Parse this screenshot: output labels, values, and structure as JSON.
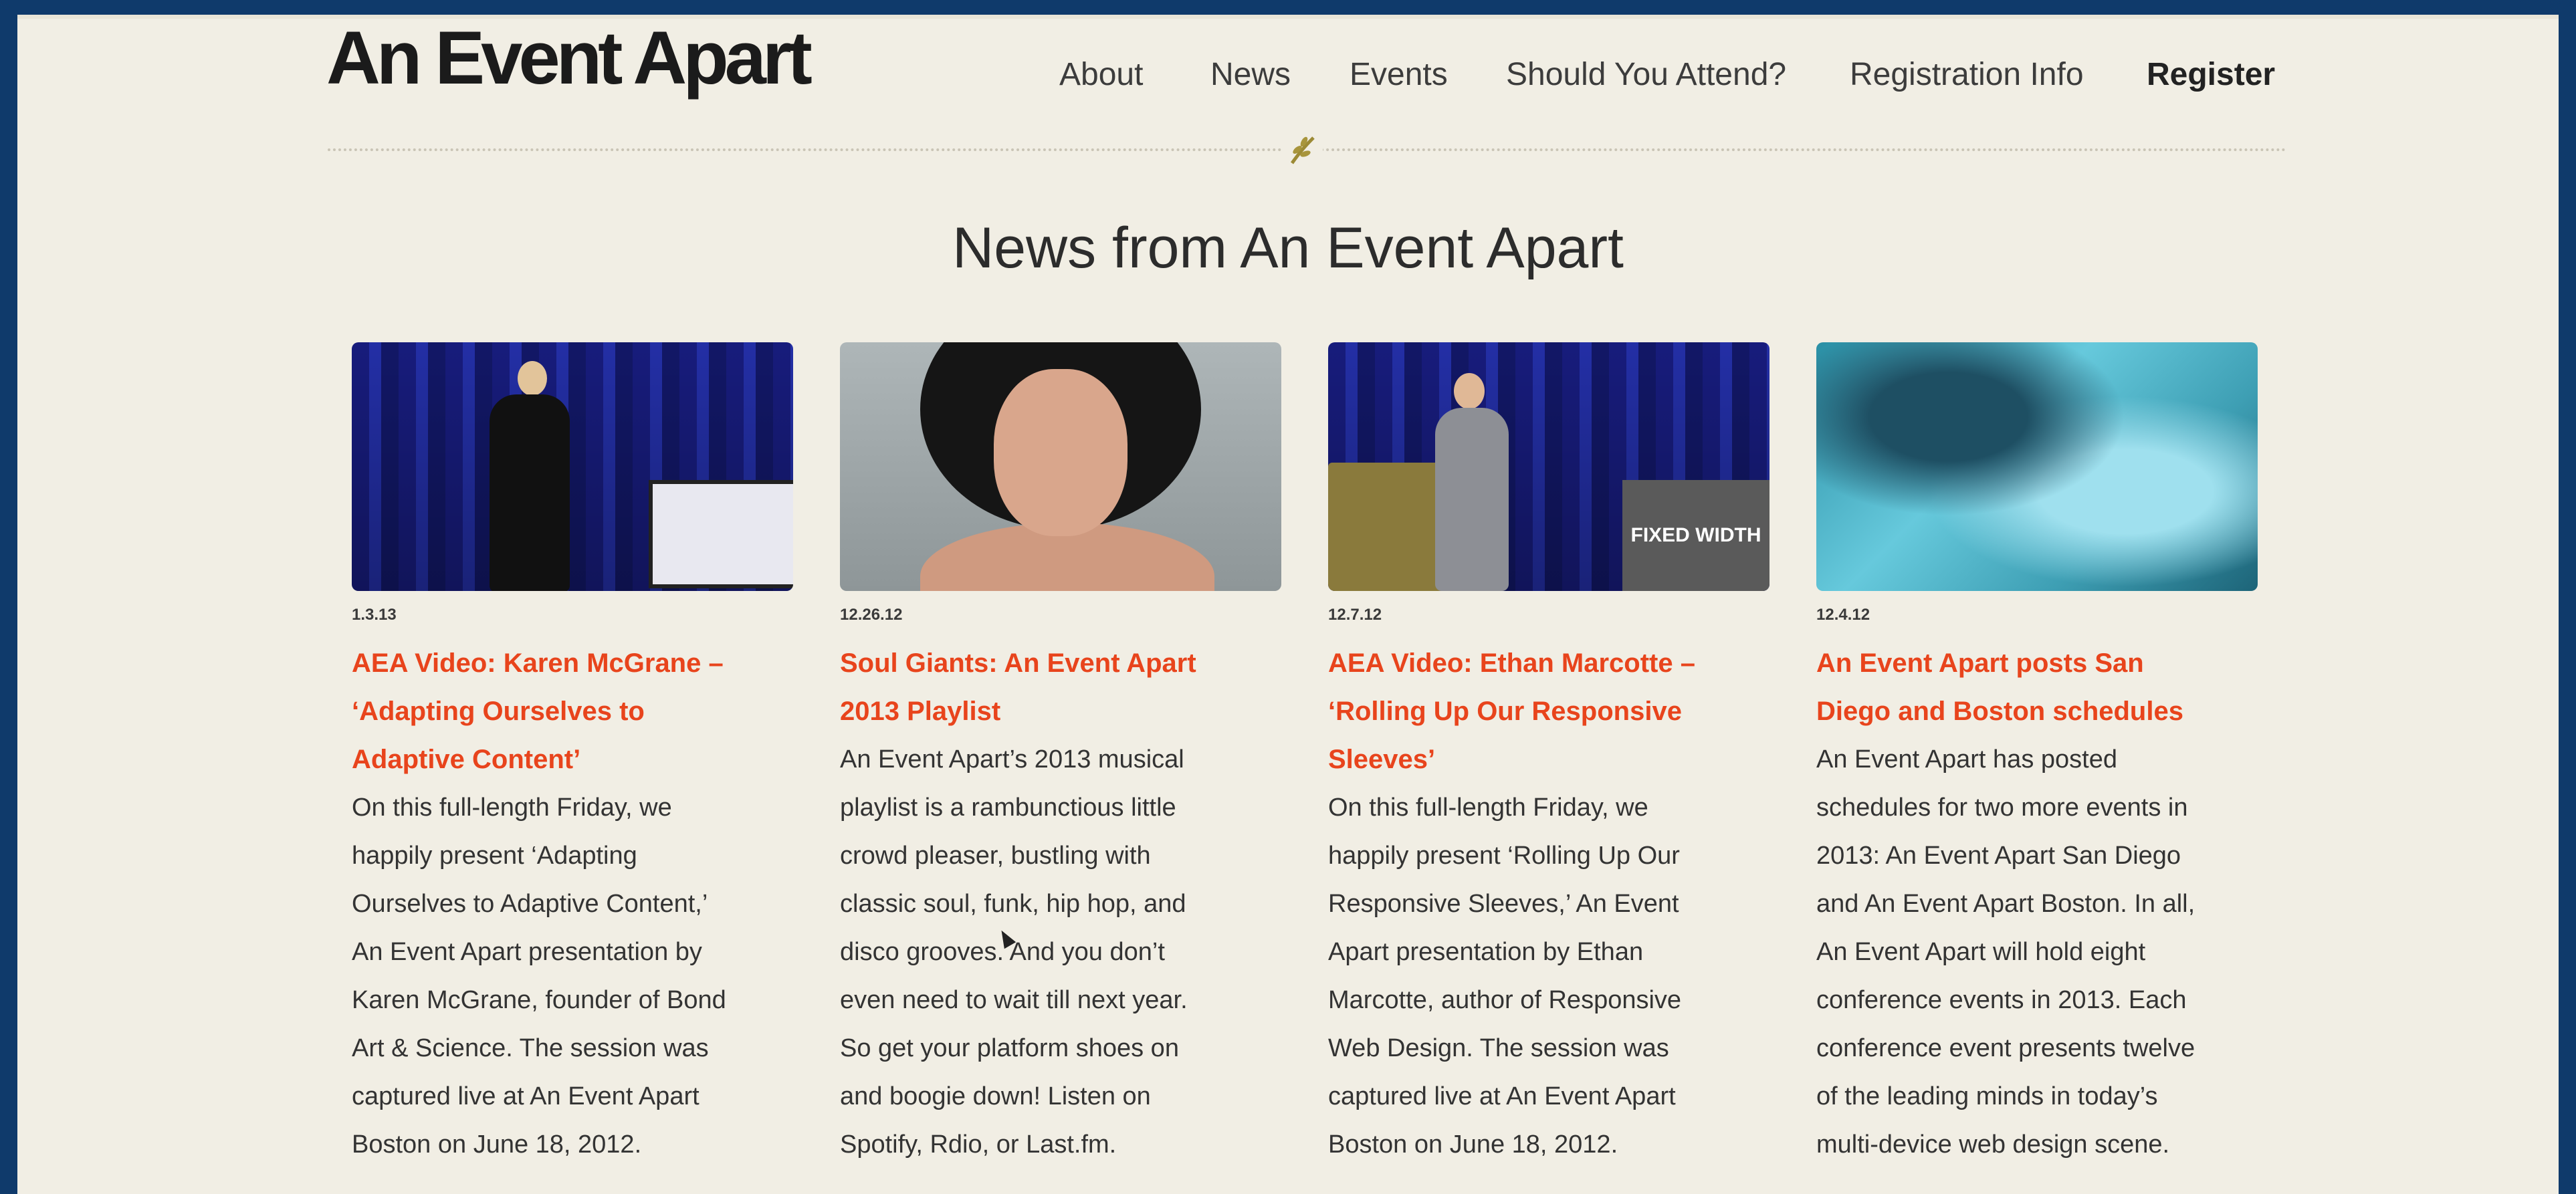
{
  "site": {
    "logo": "An Event Apart"
  },
  "nav": {
    "items": [
      "About",
      "News",
      "Events",
      "Should You Attend?",
      "Registration Info"
    ],
    "register": "Register"
  },
  "page": {
    "headline": "News from An Event Apart"
  },
  "cards": [
    {
      "date": "1.3.13",
      "title_lines": [
        "AEA Video: Karen McGrane –",
        "‘Adapting Ourselves to",
        "Adaptive Content’"
      ],
      "body_lines": [
        "On this full-length Friday, we",
        "happily present ‘Adapting",
        "Ourselves to Adaptive Content,’",
        "An Event Apart presentation by",
        "Karen McGrane, founder of Bond",
        "Art & Science. The session was",
        "captured live at An Event Apart",
        "Boston on June 18, 2012."
      ]
    },
    {
      "date": "12.26.12",
      "title_lines": [
        "Soul Giants: An Event Apart",
        "2013 Playlist"
      ],
      "body_lines": [
        "An Event Apart’s 2013 musical",
        "playlist is a rambunctious little",
        "crowd pleaser, bustling with",
        "classic soul, funk, hip hop, and",
        "disco grooves. And you don’t",
        "even need to wait till next year.",
        "So get your platform shoes on",
        "and boogie down! Listen on",
        "Spotify, Rdio, or Last.fm."
      ]
    },
    {
      "date": "12.7.12",
      "title_lines": [
        "AEA Video: Ethan Marcotte –",
        " ‘Rolling Up Our Responsive",
        "Sleeves’"
      ],
      "body_lines": [
        "On this full-length Friday, we",
        "happily present ‘Rolling Up Our",
        "Responsive Sleeves,’ An Event",
        "Apart presentation by Ethan",
        "Marcotte, author of Responsive",
        "Web Design. The session was",
        "captured live at An Event Apart",
        "Boston on June 18, 2012."
      ],
      "thumb_label": "FIXED WIDTH"
    },
    {
      "date": "12.4.12",
      "title_lines": [
        "An Event Apart posts San",
        "Diego and Boston schedules"
      ],
      "body_lines": [
        "An Event Apart has posted",
        "schedules for two more events in",
        "2013: An Event Apart San Diego",
        "and An Event Apart Boston. In all,",
        "An Event Apart will hold eight",
        "conference events in 2013. Each",
        "conference event presents twelve",
        "of the leading minds in today’s",
        "multi-device web design scene."
      ]
    }
  ]
}
